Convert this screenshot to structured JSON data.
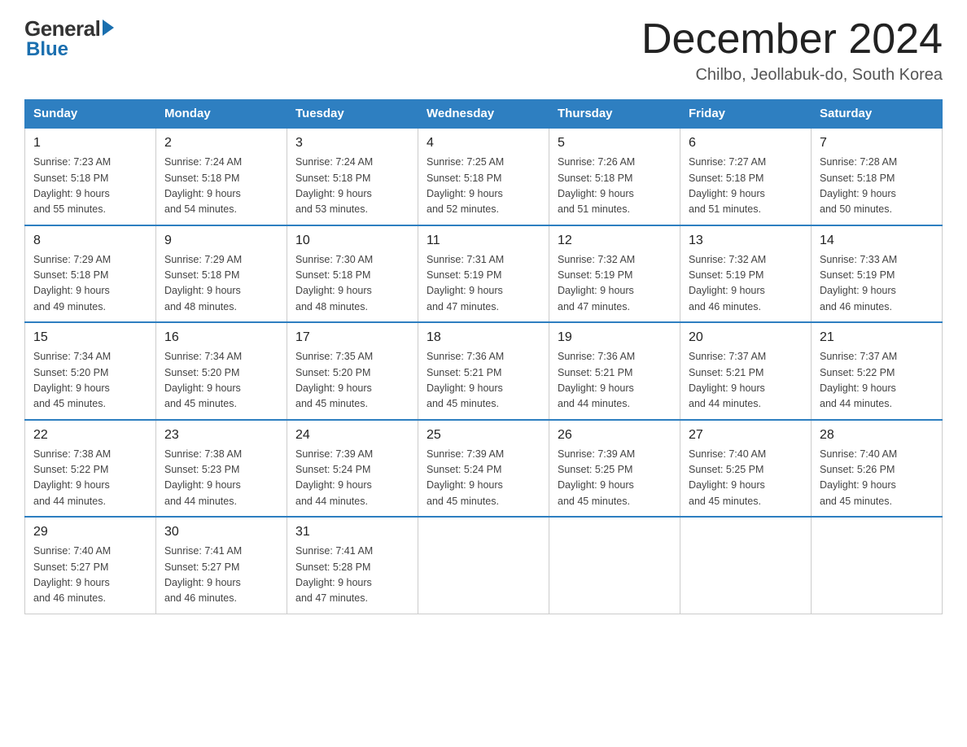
{
  "header": {
    "logo_general": "General",
    "logo_blue": "Blue",
    "title": "December 2024",
    "subtitle": "Chilbo, Jeollabuk-do, South Korea"
  },
  "days_of_week": [
    "Sunday",
    "Monday",
    "Tuesday",
    "Wednesday",
    "Thursday",
    "Friday",
    "Saturday"
  ],
  "weeks": [
    [
      {
        "day": "1",
        "info": "Sunrise: 7:23 AM\nSunset: 5:18 PM\nDaylight: 9 hours\nand 55 minutes."
      },
      {
        "day": "2",
        "info": "Sunrise: 7:24 AM\nSunset: 5:18 PM\nDaylight: 9 hours\nand 54 minutes."
      },
      {
        "day": "3",
        "info": "Sunrise: 7:24 AM\nSunset: 5:18 PM\nDaylight: 9 hours\nand 53 minutes."
      },
      {
        "day": "4",
        "info": "Sunrise: 7:25 AM\nSunset: 5:18 PM\nDaylight: 9 hours\nand 52 minutes."
      },
      {
        "day": "5",
        "info": "Sunrise: 7:26 AM\nSunset: 5:18 PM\nDaylight: 9 hours\nand 51 minutes."
      },
      {
        "day": "6",
        "info": "Sunrise: 7:27 AM\nSunset: 5:18 PM\nDaylight: 9 hours\nand 51 minutes."
      },
      {
        "day": "7",
        "info": "Sunrise: 7:28 AM\nSunset: 5:18 PM\nDaylight: 9 hours\nand 50 minutes."
      }
    ],
    [
      {
        "day": "8",
        "info": "Sunrise: 7:29 AM\nSunset: 5:18 PM\nDaylight: 9 hours\nand 49 minutes."
      },
      {
        "day": "9",
        "info": "Sunrise: 7:29 AM\nSunset: 5:18 PM\nDaylight: 9 hours\nand 48 minutes."
      },
      {
        "day": "10",
        "info": "Sunrise: 7:30 AM\nSunset: 5:18 PM\nDaylight: 9 hours\nand 48 minutes."
      },
      {
        "day": "11",
        "info": "Sunrise: 7:31 AM\nSunset: 5:19 PM\nDaylight: 9 hours\nand 47 minutes."
      },
      {
        "day": "12",
        "info": "Sunrise: 7:32 AM\nSunset: 5:19 PM\nDaylight: 9 hours\nand 47 minutes."
      },
      {
        "day": "13",
        "info": "Sunrise: 7:32 AM\nSunset: 5:19 PM\nDaylight: 9 hours\nand 46 minutes."
      },
      {
        "day": "14",
        "info": "Sunrise: 7:33 AM\nSunset: 5:19 PM\nDaylight: 9 hours\nand 46 minutes."
      }
    ],
    [
      {
        "day": "15",
        "info": "Sunrise: 7:34 AM\nSunset: 5:20 PM\nDaylight: 9 hours\nand 45 minutes."
      },
      {
        "day": "16",
        "info": "Sunrise: 7:34 AM\nSunset: 5:20 PM\nDaylight: 9 hours\nand 45 minutes."
      },
      {
        "day": "17",
        "info": "Sunrise: 7:35 AM\nSunset: 5:20 PM\nDaylight: 9 hours\nand 45 minutes."
      },
      {
        "day": "18",
        "info": "Sunrise: 7:36 AM\nSunset: 5:21 PM\nDaylight: 9 hours\nand 45 minutes."
      },
      {
        "day": "19",
        "info": "Sunrise: 7:36 AM\nSunset: 5:21 PM\nDaylight: 9 hours\nand 44 minutes."
      },
      {
        "day": "20",
        "info": "Sunrise: 7:37 AM\nSunset: 5:21 PM\nDaylight: 9 hours\nand 44 minutes."
      },
      {
        "day": "21",
        "info": "Sunrise: 7:37 AM\nSunset: 5:22 PM\nDaylight: 9 hours\nand 44 minutes."
      }
    ],
    [
      {
        "day": "22",
        "info": "Sunrise: 7:38 AM\nSunset: 5:22 PM\nDaylight: 9 hours\nand 44 minutes."
      },
      {
        "day": "23",
        "info": "Sunrise: 7:38 AM\nSunset: 5:23 PM\nDaylight: 9 hours\nand 44 minutes."
      },
      {
        "day": "24",
        "info": "Sunrise: 7:39 AM\nSunset: 5:24 PM\nDaylight: 9 hours\nand 44 minutes."
      },
      {
        "day": "25",
        "info": "Sunrise: 7:39 AM\nSunset: 5:24 PM\nDaylight: 9 hours\nand 45 minutes."
      },
      {
        "day": "26",
        "info": "Sunrise: 7:39 AM\nSunset: 5:25 PM\nDaylight: 9 hours\nand 45 minutes."
      },
      {
        "day": "27",
        "info": "Sunrise: 7:40 AM\nSunset: 5:25 PM\nDaylight: 9 hours\nand 45 minutes."
      },
      {
        "day": "28",
        "info": "Sunrise: 7:40 AM\nSunset: 5:26 PM\nDaylight: 9 hours\nand 45 minutes."
      }
    ],
    [
      {
        "day": "29",
        "info": "Sunrise: 7:40 AM\nSunset: 5:27 PM\nDaylight: 9 hours\nand 46 minutes."
      },
      {
        "day": "30",
        "info": "Sunrise: 7:41 AM\nSunset: 5:27 PM\nDaylight: 9 hours\nand 46 minutes."
      },
      {
        "day": "31",
        "info": "Sunrise: 7:41 AM\nSunset: 5:28 PM\nDaylight: 9 hours\nand 47 minutes."
      },
      {
        "day": "",
        "info": ""
      },
      {
        "day": "",
        "info": ""
      },
      {
        "day": "",
        "info": ""
      },
      {
        "day": "",
        "info": ""
      }
    ]
  ]
}
